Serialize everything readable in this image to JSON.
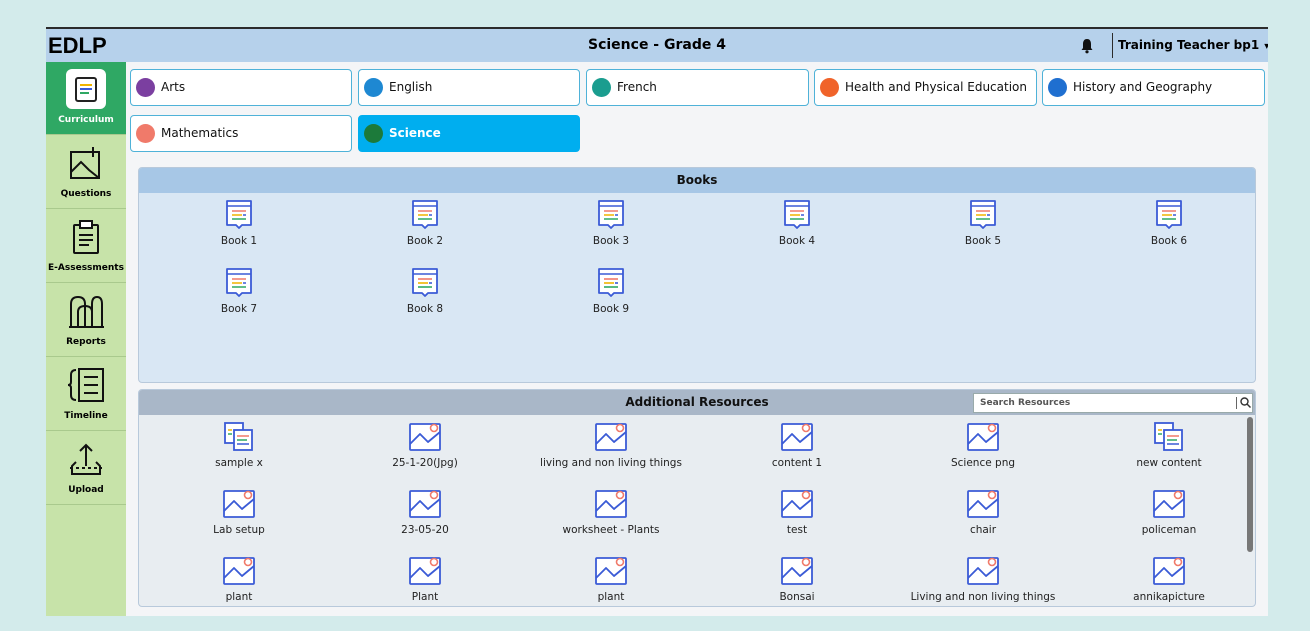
{
  "header": {
    "brand": "EDLP",
    "title": "Science - Grade 4",
    "user": "Training Teacher bp1",
    "icons": {
      "notifications": "bell-icon",
      "user_menu": "caret-down-icon"
    }
  },
  "sidebar": {
    "items": [
      {
        "label": "Curriculum",
        "icon": "curriculum-icon",
        "active": true
      },
      {
        "label": "Questions",
        "icon": "questions-icon"
      },
      {
        "label": "E-Assessments",
        "icon": "clipboard-icon"
      },
      {
        "label": "Reports",
        "icon": "reports-icon"
      },
      {
        "label": "Timeline",
        "icon": "timeline-icon"
      },
      {
        "label": "Upload",
        "icon": "upload-icon"
      }
    ]
  },
  "subjects": [
    {
      "label": "Arts",
      "color": "#7b3fa0"
    },
    {
      "label": "English",
      "color": "#1e88d2"
    },
    {
      "label": "French",
      "color": "#1a9d8f"
    },
    {
      "label": "Health and Physical Education",
      "color": "#f0632a"
    },
    {
      "label": "History and Geography",
      "color": "#1f6fd0"
    },
    {
      "label": "Mathematics",
      "color": "#f07a6a"
    },
    {
      "label": "Science",
      "color": "#1c7a3a",
      "active": true
    }
  ],
  "books": {
    "title": "Books",
    "items": [
      "Book 1",
      "Book 2",
      "Book 3",
      "Book 4",
      "Book 5",
      "Book 6",
      "Book 7",
      "Book 8",
      "Book 9"
    ]
  },
  "resources": {
    "title": "Additional Resources",
    "search_placeholder": "Search Resources",
    "items": [
      {
        "label": "sample x",
        "type": "document"
      },
      {
        "label": "25-1-20(Jpg)",
        "type": "image"
      },
      {
        "label": "living and non living things",
        "type": "image"
      },
      {
        "label": "content 1",
        "type": "image"
      },
      {
        "label": "Science png",
        "type": "image"
      },
      {
        "label": "new content",
        "type": "document"
      },
      {
        "label": "Lab setup",
        "type": "image"
      },
      {
        "label": "23-05-20",
        "type": "image"
      },
      {
        "label": "worksheet - Plants",
        "type": "image"
      },
      {
        "label": "test",
        "type": "image"
      },
      {
        "label": "chair",
        "type": "image"
      },
      {
        "label": "policeman",
        "type": "image"
      },
      {
        "label": "plant",
        "type": "image"
      },
      {
        "label": "Plant",
        "type": "image"
      },
      {
        "label": "plant",
        "type": "image"
      },
      {
        "label": "Bonsai",
        "type": "image"
      },
      {
        "label": "Living and non living things",
        "type": "image"
      },
      {
        "label": "annikapicture",
        "type": "image"
      }
    ]
  },
  "colors": {
    "header": "#b6d1eb",
    "sidebar": "#c7e3a9",
    "sidebar_active": "#2fa864",
    "tab_active": "#00aeef",
    "icon_blue": "#3b5bd6"
  }
}
